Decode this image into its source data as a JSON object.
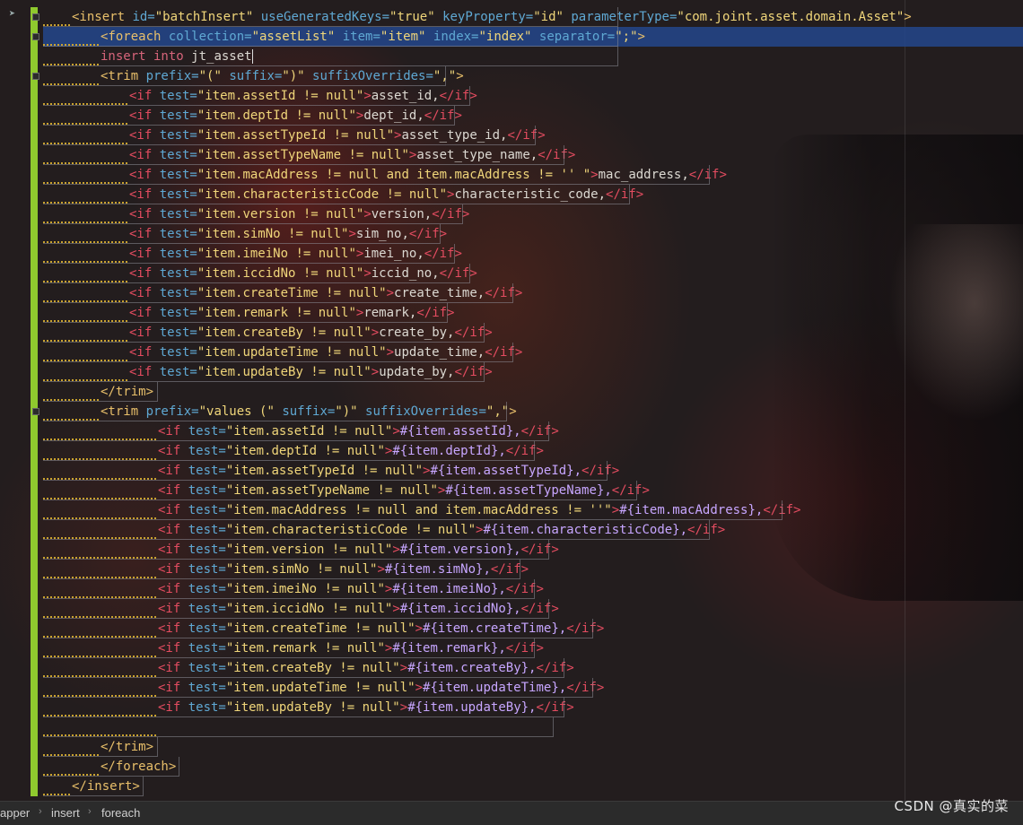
{
  "lines": [
    [
      [
        "t-tag",
        "<insert "
      ],
      [
        "t-attr",
        "id="
      ],
      [
        "t-str",
        "\"batchInsert\" "
      ],
      [
        "t-attr",
        "useGeneratedKeys="
      ],
      [
        "t-str",
        "\"true\" "
      ],
      [
        "t-attr",
        "keyProperty="
      ],
      [
        "t-str",
        "\"id\" "
      ],
      [
        "t-attr",
        "parameterType="
      ],
      [
        "t-str",
        "\"com.joint.asset.domain.Asset\""
      ],
      [
        "t-tag",
        ">"
      ]
    ],
    [
      [
        "t-tag",
        "<foreach "
      ],
      [
        "t-attr",
        "collection="
      ],
      [
        "t-str",
        "\"assetList\" "
      ],
      [
        "t-attr",
        "item="
      ],
      [
        "t-str",
        "\"item\" "
      ],
      [
        "t-attr",
        "index="
      ],
      [
        "t-str",
        "\"index\" "
      ],
      [
        "t-attr",
        "separator="
      ],
      [
        "t-str",
        "\";\""
      ],
      [
        "t-tag",
        ">"
      ]
    ],
    [
      [
        "t-sql",
        "insert into "
      ],
      [
        "t-text",
        "jt_asset"
      ]
    ],
    [
      [
        "t-tag",
        "<trim "
      ],
      [
        "t-attr",
        "prefix="
      ],
      [
        "t-str",
        "\"(\" "
      ],
      [
        "t-attr",
        "suffix="
      ],
      [
        "t-str",
        "\")\" "
      ],
      [
        "t-attr",
        "suffixOverrides="
      ],
      [
        "t-str",
        "\",\""
      ],
      [
        "t-tag",
        ">"
      ]
    ],
    [
      [
        "t-ifkw",
        "<if "
      ],
      [
        "t-attr",
        "test="
      ],
      [
        "t-str",
        "\"item.assetId != null\""
      ],
      [
        "t-ifkw",
        ">"
      ],
      [
        "t-text",
        "asset_id,"
      ],
      [
        "t-close",
        "</if>"
      ]
    ],
    [
      [
        "t-ifkw",
        "<if "
      ],
      [
        "t-attr",
        "test="
      ],
      [
        "t-str",
        "\"item.deptId != null\""
      ],
      [
        "t-ifkw",
        ">"
      ],
      [
        "t-text",
        "dept_id,"
      ],
      [
        "t-close",
        "</if>"
      ]
    ],
    [
      [
        "t-ifkw",
        "<if "
      ],
      [
        "t-attr",
        "test="
      ],
      [
        "t-str",
        "\"item.assetTypeId != null\""
      ],
      [
        "t-ifkw",
        ">"
      ],
      [
        "t-text",
        "asset_type_id,"
      ],
      [
        "t-close",
        "</if>"
      ]
    ],
    [
      [
        "t-ifkw",
        "<if "
      ],
      [
        "t-attr",
        "test="
      ],
      [
        "t-str",
        "\"item.assetTypeName != null\""
      ],
      [
        "t-ifkw",
        ">"
      ],
      [
        "t-text",
        "asset_type_name,"
      ],
      [
        "t-close",
        "</if>"
      ]
    ],
    [
      [
        "t-ifkw",
        "<if "
      ],
      [
        "t-attr",
        "test="
      ],
      [
        "t-str",
        "\"item.macAddress != null and item.macAddress != '' \""
      ],
      [
        "t-ifkw",
        ">"
      ],
      [
        "t-text",
        "mac_address,"
      ],
      [
        "t-close",
        "</if>"
      ]
    ],
    [
      [
        "t-ifkw",
        "<if "
      ],
      [
        "t-attr",
        "test="
      ],
      [
        "t-str",
        "\"item.characteristicCode != null\""
      ],
      [
        "t-ifkw",
        ">"
      ],
      [
        "t-text",
        "characteristic_code,"
      ],
      [
        "t-close",
        "</if>"
      ]
    ],
    [
      [
        "t-ifkw",
        "<if "
      ],
      [
        "t-attr",
        "test="
      ],
      [
        "t-str",
        "\"item.version != null\""
      ],
      [
        "t-ifkw",
        ">"
      ],
      [
        "t-text",
        "version,"
      ],
      [
        "t-close",
        "</if>"
      ]
    ],
    [
      [
        "t-ifkw",
        "<if "
      ],
      [
        "t-attr",
        "test="
      ],
      [
        "t-str",
        "\"item.simNo != null\""
      ],
      [
        "t-ifkw",
        ">"
      ],
      [
        "t-text",
        "sim_no,"
      ],
      [
        "t-close",
        "</if>"
      ]
    ],
    [
      [
        "t-ifkw",
        "<if "
      ],
      [
        "t-attr",
        "test="
      ],
      [
        "t-str",
        "\"item.imeiNo != null\""
      ],
      [
        "t-ifkw",
        ">"
      ],
      [
        "t-text",
        "imei_no,"
      ],
      [
        "t-close",
        "</if>"
      ]
    ],
    [
      [
        "t-ifkw",
        "<if "
      ],
      [
        "t-attr",
        "test="
      ],
      [
        "t-str",
        "\"item.iccidNo != null\""
      ],
      [
        "t-ifkw",
        ">"
      ],
      [
        "t-text",
        "iccid_no,"
      ],
      [
        "t-close",
        "</if>"
      ]
    ],
    [
      [
        "t-ifkw",
        "<if "
      ],
      [
        "t-attr",
        "test="
      ],
      [
        "t-str",
        "\"item.createTime != null\""
      ],
      [
        "t-ifkw",
        ">"
      ],
      [
        "t-text",
        "create_time,"
      ],
      [
        "t-close",
        "</if>"
      ]
    ],
    [
      [
        "t-ifkw",
        "<if "
      ],
      [
        "t-attr",
        "test="
      ],
      [
        "t-str",
        "\"item.remark != null\""
      ],
      [
        "t-ifkw",
        ">"
      ],
      [
        "t-text",
        "remark,"
      ],
      [
        "t-close",
        "</if>"
      ]
    ],
    [
      [
        "t-ifkw",
        "<if "
      ],
      [
        "t-attr",
        "test="
      ],
      [
        "t-str",
        "\"item.createBy != null\""
      ],
      [
        "t-ifkw",
        ">"
      ],
      [
        "t-text",
        "create_by,"
      ],
      [
        "t-close",
        "</if>"
      ]
    ],
    [
      [
        "t-ifkw",
        "<if "
      ],
      [
        "t-attr",
        "test="
      ],
      [
        "t-str",
        "\"item.updateTime != null\""
      ],
      [
        "t-ifkw",
        ">"
      ],
      [
        "t-text",
        "update_time,"
      ],
      [
        "t-close",
        "</if>"
      ]
    ],
    [
      [
        "t-ifkw",
        "<if "
      ],
      [
        "t-attr",
        "test="
      ],
      [
        "t-str",
        "\"item.updateBy != null\""
      ],
      [
        "t-ifkw",
        ">"
      ],
      [
        "t-text",
        "update_by,"
      ],
      [
        "t-close",
        "</if>"
      ]
    ],
    [
      [
        "t-tag",
        "</trim>"
      ]
    ],
    [
      [
        "t-tag",
        "<trim "
      ],
      [
        "t-attr",
        "prefix="
      ],
      [
        "t-str",
        "\"values (\" "
      ],
      [
        "t-attr",
        "suffix="
      ],
      [
        "t-str",
        "\")\" "
      ],
      [
        "t-attr",
        "suffixOverrides="
      ],
      [
        "t-str",
        "\",\""
      ],
      [
        "t-tag",
        ">"
      ]
    ],
    [
      [
        "t-ifkw",
        "<if "
      ],
      [
        "t-attr",
        "test="
      ],
      [
        "t-str",
        "\"item.assetId != null\""
      ],
      [
        "t-ifkw",
        ">"
      ],
      [
        "t-expr",
        "#{item.assetId},"
      ],
      [
        "t-close",
        "</if>"
      ]
    ],
    [
      [
        "t-ifkw",
        "<if "
      ],
      [
        "t-attr",
        "test="
      ],
      [
        "t-str",
        "\"item.deptId != null\""
      ],
      [
        "t-ifkw",
        ">"
      ],
      [
        "t-expr",
        "#{item.deptId},"
      ],
      [
        "t-close",
        "</if>"
      ]
    ],
    [
      [
        "t-ifkw",
        "<if "
      ],
      [
        "t-attr",
        "test="
      ],
      [
        "t-str",
        "\"item.assetTypeId != null\""
      ],
      [
        "t-ifkw",
        ">"
      ],
      [
        "t-expr",
        "#{item.assetTypeId},"
      ],
      [
        "t-close",
        "</if>"
      ]
    ],
    [
      [
        "t-ifkw",
        "<if "
      ],
      [
        "t-attr",
        "test="
      ],
      [
        "t-str",
        "\"item.assetTypeName != null\""
      ],
      [
        "t-ifkw",
        ">"
      ],
      [
        "t-expr",
        "#{item.assetTypeName},"
      ],
      [
        "t-close",
        "</if>"
      ]
    ],
    [
      [
        "t-ifkw",
        "<if "
      ],
      [
        "t-attr",
        "test="
      ],
      [
        "t-str",
        "\"item.macAddress != null and item.macAddress != ''\""
      ],
      [
        "t-ifkw",
        ">"
      ],
      [
        "t-expr",
        "#{item.macAddress},"
      ],
      [
        "t-close",
        "</if>"
      ]
    ],
    [
      [
        "t-ifkw",
        "<if "
      ],
      [
        "t-attr",
        "test="
      ],
      [
        "t-str",
        "\"item.characteristicCode != null\""
      ],
      [
        "t-ifkw",
        ">"
      ],
      [
        "t-expr",
        "#{item.characteristicCode},"
      ],
      [
        "t-close",
        "</if>"
      ]
    ],
    [
      [
        "t-ifkw",
        "<if "
      ],
      [
        "t-attr",
        "test="
      ],
      [
        "t-str",
        "\"item.version != null\""
      ],
      [
        "t-ifkw",
        ">"
      ],
      [
        "t-expr",
        "#{item.version},"
      ],
      [
        "t-close",
        "</if>"
      ]
    ],
    [
      [
        "t-ifkw",
        "<if "
      ],
      [
        "t-attr",
        "test="
      ],
      [
        "t-str",
        "\"item.simNo != null\""
      ],
      [
        "t-ifkw",
        ">"
      ],
      [
        "t-expr",
        "#{item.simNo},"
      ],
      [
        "t-close",
        "</if>"
      ]
    ],
    [
      [
        "t-ifkw",
        "<if "
      ],
      [
        "t-attr",
        "test="
      ],
      [
        "t-str",
        "\"item.imeiNo != null\""
      ],
      [
        "t-ifkw",
        ">"
      ],
      [
        "t-expr",
        "#{item.imeiNo},"
      ],
      [
        "t-close",
        "</if>"
      ]
    ],
    [
      [
        "t-ifkw",
        "<if "
      ],
      [
        "t-attr",
        "test="
      ],
      [
        "t-str",
        "\"item.iccidNo != null\""
      ],
      [
        "t-ifkw",
        ">"
      ],
      [
        "t-expr",
        "#{item.iccidNo},"
      ],
      [
        "t-close",
        "</if>"
      ]
    ],
    [
      [
        "t-ifkw",
        "<if "
      ],
      [
        "t-attr",
        "test="
      ],
      [
        "t-str",
        "\"item.createTime != null\""
      ],
      [
        "t-ifkw",
        ">"
      ],
      [
        "t-expr",
        "#{item.createTime},"
      ],
      [
        "t-close",
        "</if>"
      ]
    ],
    [
      [
        "t-ifkw",
        "<if "
      ],
      [
        "t-attr",
        "test="
      ],
      [
        "t-str",
        "\"item.remark != null\""
      ],
      [
        "t-ifkw",
        ">"
      ],
      [
        "t-expr",
        "#{item.remark},"
      ],
      [
        "t-close",
        "</if>"
      ]
    ],
    [
      [
        "t-ifkw",
        "<if "
      ],
      [
        "t-attr",
        "test="
      ],
      [
        "t-str",
        "\"item.createBy != null\""
      ],
      [
        "t-ifkw",
        ">"
      ],
      [
        "t-expr",
        "#{item.createBy},"
      ],
      [
        "t-close",
        "</if>"
      ]
    ],
    [
      [
        "t-ifkw",
        "<if "
      ],
      [
        "t-attr",
        "test="
      ],
      [
        "t-str",
        "\"item.updateTime != null\""
      ],
      [
        "t-ifkw",
        ">"
      ],
      [
        "t-expr",
        "#{item.updateTime},"
      ],
      [
        "t-close",
        "</if>"
      ]
    ],
    [
      [
        "t-ifkw",
        "<if "
      ],
      [
        "t-attr",
        "test="
      ],
      [
        "t-str",
        "\"item.updateBy != null\""
      ],
      [
        "t-ifkw",
        ">"
      ],
      [
        "t-expr",
        "#{item.updateBy},"
      ],
      [
        "t-close",
        "</if>"
      ]
    ],
    [],
    [
      [
        "t-tag",
        "</trim>"
      ]
    ],
    [
      [
        "t-tag",
        "</foreach>"
      ]
    ],
    [
      [
        "t-tag",
        "</insert>"
      ]
    ]
  ],
  "breadcrumb": [
    "apper",
    "insert",
    "foreach"
  ],
  "watermark": "CSDN @真实的菜",
  "colors": {
    "change_bar": "#8fc92e",
    "selection": "#23468c"
  }
}
